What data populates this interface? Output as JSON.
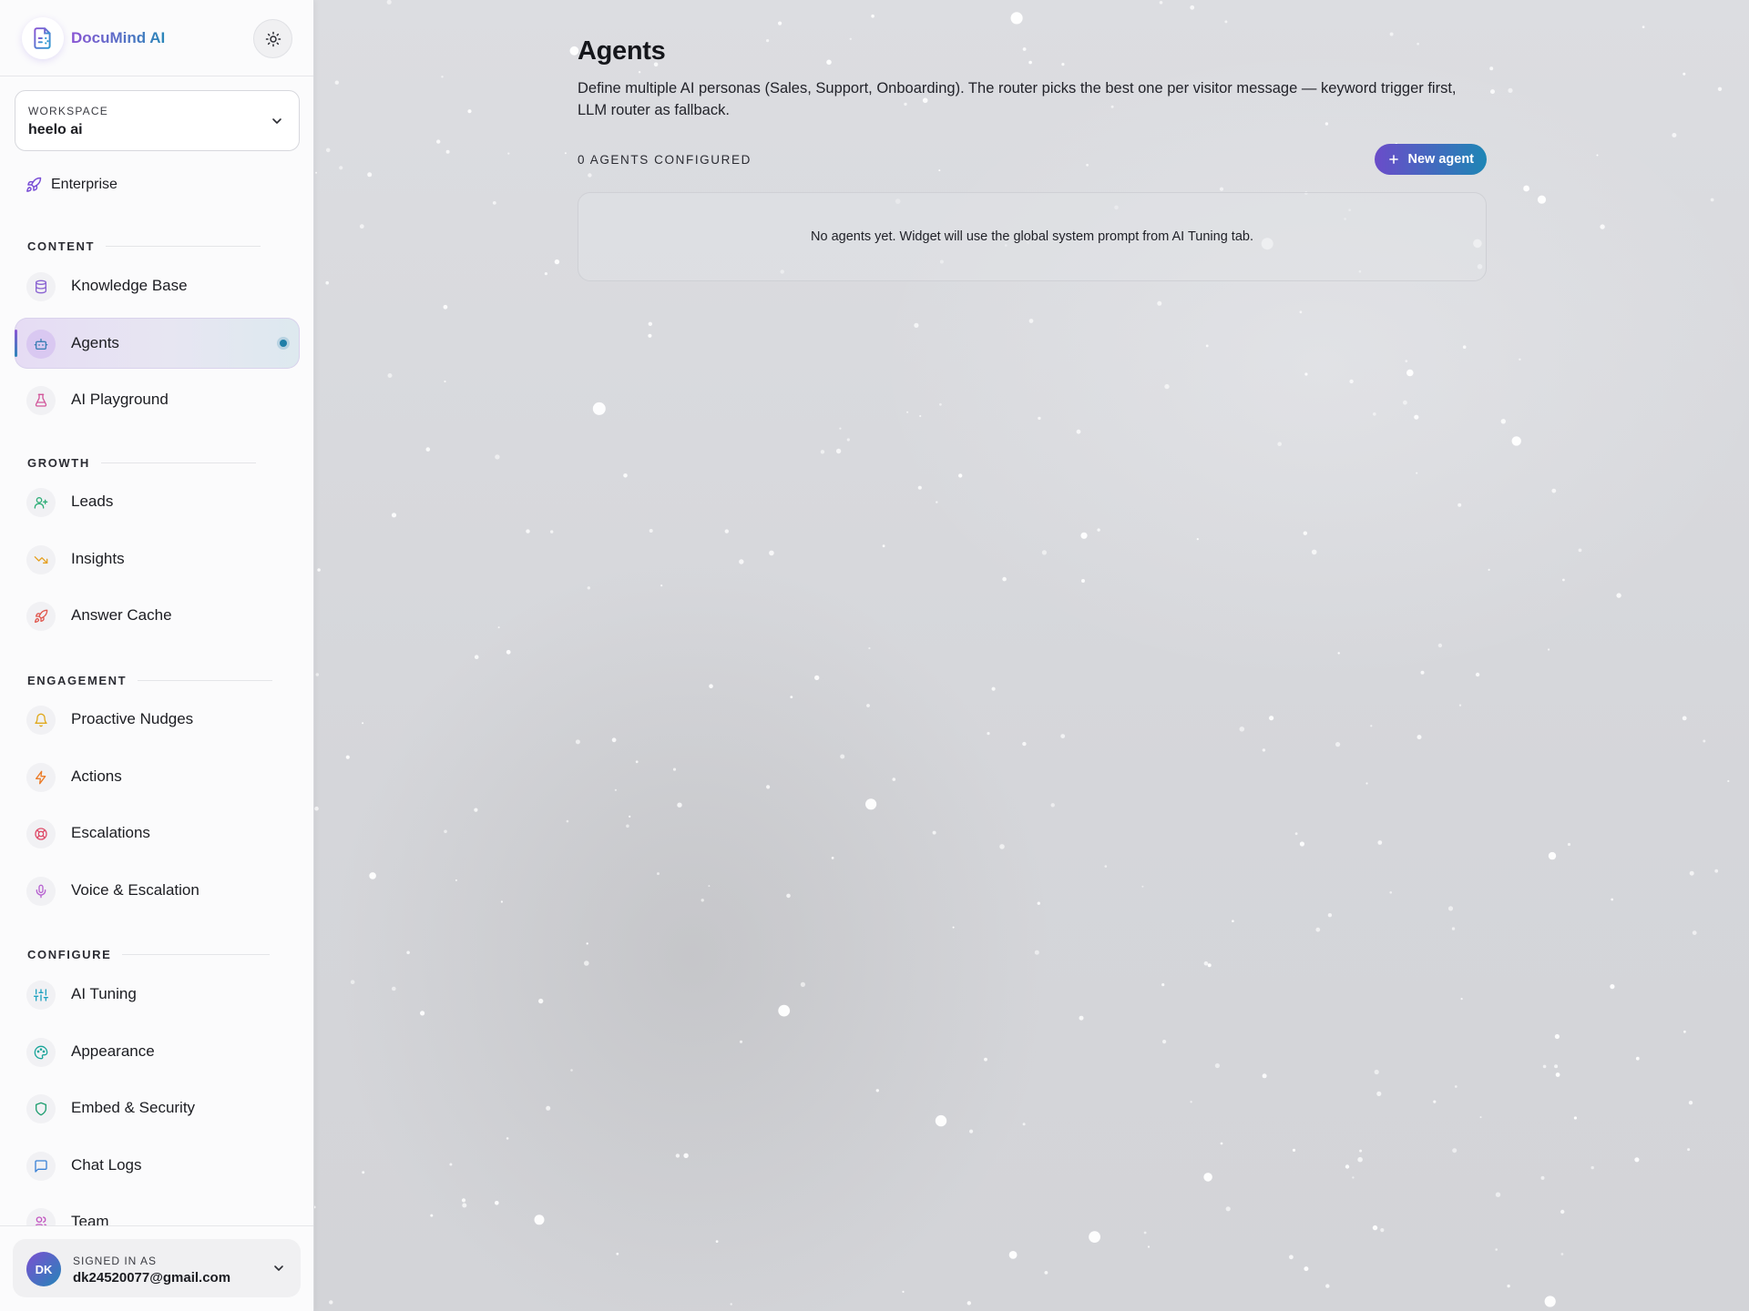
{
  "app": {
    "name": "DocuMind AI",
    "theme_icon": "sun-icon"
  },
  "workspace": {
    "label": "WORKSPACE",
    "value": "heelo ai"
  },
  "plan": {
    "label": "Enterprise",
    "icon": "rocket-icon",
    "color": "#7a4fd6"
  },
  "sidebar": {
    "sections": [
      {
        "title": "CONTENT",
        "items": [
          {
            "label": "Knowledge Base",
            "icon": "database-icon",
            "color": "#8a63d2"
          },
          {
            "label": "Agents",
            "icon": "robot-icon",
            "color": "#3d7fb5",
            "active": true
          },
          {
            "label": "AI Playground",
            "icon": "flask-icon",
            "color": "#d2569a"
          }
        ]
      },
      {
        "title": "GROWTH",
        "items": [
          {
            "label": "Leads",
            "icon": "user-plus-icon",
            "color": "#2fae78"
          },
          {
            "label": "Insights",
            "icon": "trending-down-icon",
            "color": "#e5a021"
          },
          {
            "label": "Answer Cache",
            "icon": "rocket-icon",
            "color": "#e0584f"
          }
        ]
      },
      {
        "title": "ENGAGEMENT",
        "items": [
          {
            "label": "Proactive Nudges",
            "icon": "bell-icon",
            "color": "#e0a91d"
          },
          {
            "label": "Actions",
            "icon": "lightning-icon",
            "color": "#ec7d2a"
          },
          {
            "label": "Escalations",
            "icon": "lifebuoy-icon",
            "color": "#df4d6a"
          },
          {
            "label": "Voice & Escalation",
            "icon": "microphone-icon",
            "color": "#b661d0"
          }
        ]
      },
      {
        "title": "CONFIGURE",
        "items": [
          {
            "label": "AI Tuning",
            "icon": "sliders-icon",
            "color": "#1fa2c0"
          },
          {
            "label": "Appearance",
            "icon": "palette-icon",
            "color": "#1aa59a"
          },
          {
            "label": "Embed & Security",
            "icon": "shield-icon",
            "color": "#1f9e70"
          },
          {
            "label": "Chat Logs",
            "icon": "chat-icon",
            "color": "#3b82d6"
          },
          {
            "label": "Team",
            "icon": "users-icon",
            "color": "#c254c0"
          }
        ]
      }
    ]
  },
  "user": {
    "initials": "DK",
    "signed_in_label": "SIGNED IN AS",
    "email": "dk24520077@gmail.com"
  },
  "main": {
    "title": "Agents",
    "description": "Define multiple AI personas (Sales, Support, Onboarding). The router picks the best one per visitor message — keyword trigger first, LLM router as fallback.",
    "count_label": "0 AGENTS CONFIGURED",
    "new_button_label": "New agent",
    "empty_message": "No agents yet. Widget will use the global system prompt from AI Tuning tab."
  },
  "colors": {
    "accent_start": "#6a4cc9",
    "accent_end": "#1e86b5",
    "active_dot": "#1f7fa8"
  }
}
